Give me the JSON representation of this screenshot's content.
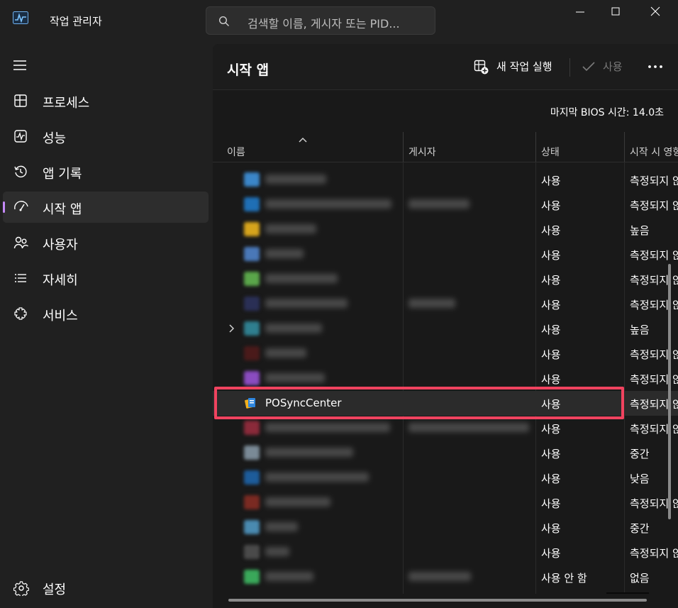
{
  "window": {
    "title": "작업 관리자",
    "search_placeholder": "검색할 이름, 게시자 또는 PID..."
  },
  "nav": {
    "items": [
      {
        "label": "프로세스",
        "icon": "processes-icon"
      },
      {
        "label": "성능",
        "icon": "performance-icon"
      },
      {
        "label": "앱 기록",
        "icon": "history-icon"
      },
      {
        "label": "시작 앱",
        "icon": "startup-apps-icon",
        "active": true
      },
      {
        "label": "사용자",
        "icon": "users-icon"
      },
      {
        "label": "자세히",
        "icon": "details-icon"
      },
      {
        "label": "서비스",
        "icon": "services-icon"
      }
    ],
    "settings": "설정"
  },
  "page": {
    "title": "시작 앱",
    "run_new_task": "새 작업 실행",
    "enable": "사용",
    "bios_time": "마지막 BIOS 시간:  14.0초"
  },
  "columns": {
    "name": "이름",
    "publisher": "게시자",
    "status": "상태",
    "impact": "시작 시 영향"
  },
  "accent_color": "#c58af9",
  "highlight_color": "#f0435f",
  "rows": [
    {
      "name": "",
      "status": "사용",
      "impact": "측정되지 않음"
    },
    {
      "name": "",
      "status": "사용",
      "impact": "측정되지 않음"
    },
    {
      "name": "",
      "status": "사용",
      "impact": "높음"
    },
    {
      "name": "",
      "status": "사용",
      "impact": "측정되지 않음"
    },
    {
      "name": "",
      "status": "사용",
      "impact": "측정되지 않음"
    },
    {
      "name": "",
      "status": "사용",
      "impact": "측정되지 않음"
    },
    {
      "name": "",
      "status": "사용",
      "impact": "높음"
    },
    {
      "name": "",
      "status": "사용",
      "impact": "측정되지 않음"
    },
    {
      "name": "",
      "status": "사용",
      "impact": "측정되지 않음"
    },
    {
      "name": "POSyncCenter",
      "status": "사용",
      "impact": "측정되지 않음"
    },
    {
      "name": "",
      "status": "사용",
      "impact": "측정되지 않음"
    },
    {
      "name": "",
      "status": "사용",
      "impact": "중간"
    },
    {
      "name": "",
      "status": "사용",
      "impact": "낮음"
    },
    {
      "name": "",
      "status": "사용",
      "impact": "측정되지 않음"
    },
    {
      "name": "",
      "status": "사용",
      "impact": "중간"
    },
    {
      "name": "",
      "status": "사용",
      "impact": "측정되지 않음"
    },
    {
      "name": "",
      "status": "사용 안 함",
      "impact": "없음"
    }
  ]
}
